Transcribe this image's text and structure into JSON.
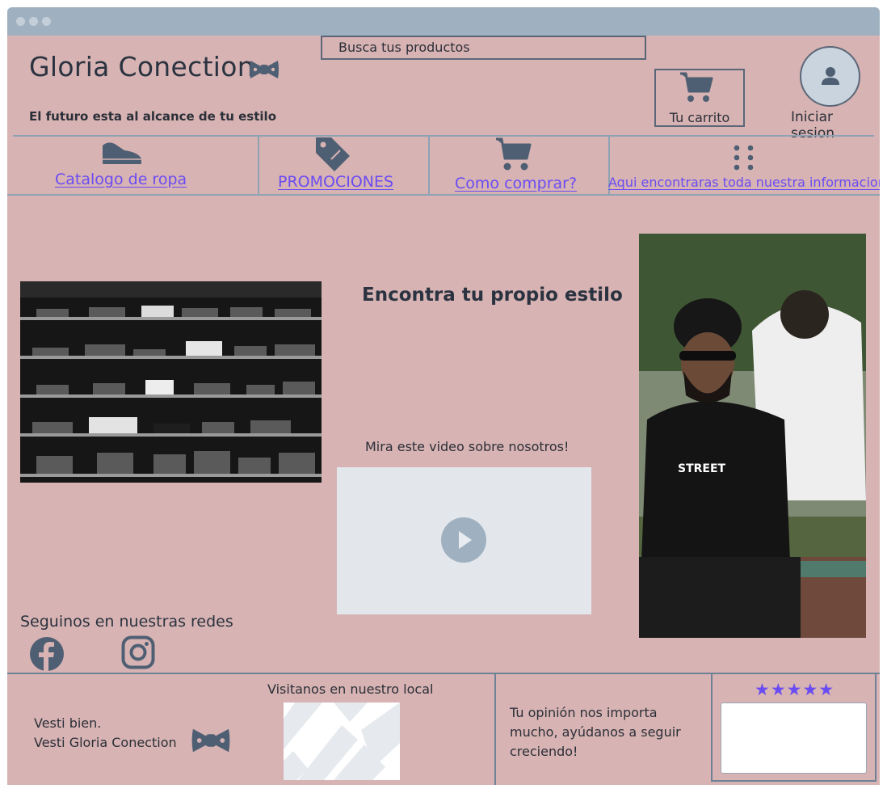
{
  "search": {
    "placeholder": "Busca tus productos"
  },
  "brand": {
    "name": "Gloria Conection",
    "tagline": "El futuro esta al alcance de tu estilo"
  },
  "header": {
    "cart_label": "Tu carrito",
    "login_label": "Iniciar sesion"
  },
  "nav": [
    {
      "label": "Catalogo de ropa",
      "icon": "shoe-icon"
    },
    {
      "label": "PROMOCIONES",
      "icon": "tag-icon"
    },
    {
      "label": "Como comprar?",
      "icon": "cart-icon"
    },
    {
      "label": "Aqui  encontraras toda nuestra informacion",
      "icon": "dots-grid-icon"
    }
  ],
  "main": {
    "headline": "Encontra tu propio estilo",
    "video_text": "Mira este video sobre nosotros!"
  },
  "social": {
    "title": "Seguinos en nuestras redes",
    "icons": [
      "facebook-icon",
      "instagram-icon"
    ]
  },
  "footer": {
    "visit_title": "Visitanos en nuestro local",
    "motto_line1": "Vesti bien.",
    "motto_line2": "Vesti Gloria Conection",
    "opinion": "Tu opinión nos importa mucho, ayúdanos a seguir creciendo!",
    "stars": "★★★★★",
    "rating": 5
  },
  "colors": {
    "background": "#d7b3b3",
    "accent": "#6a4cf2",
    "icon": "#4f5f73",
    "titlebar": "#9fb1c0"
  }
}
